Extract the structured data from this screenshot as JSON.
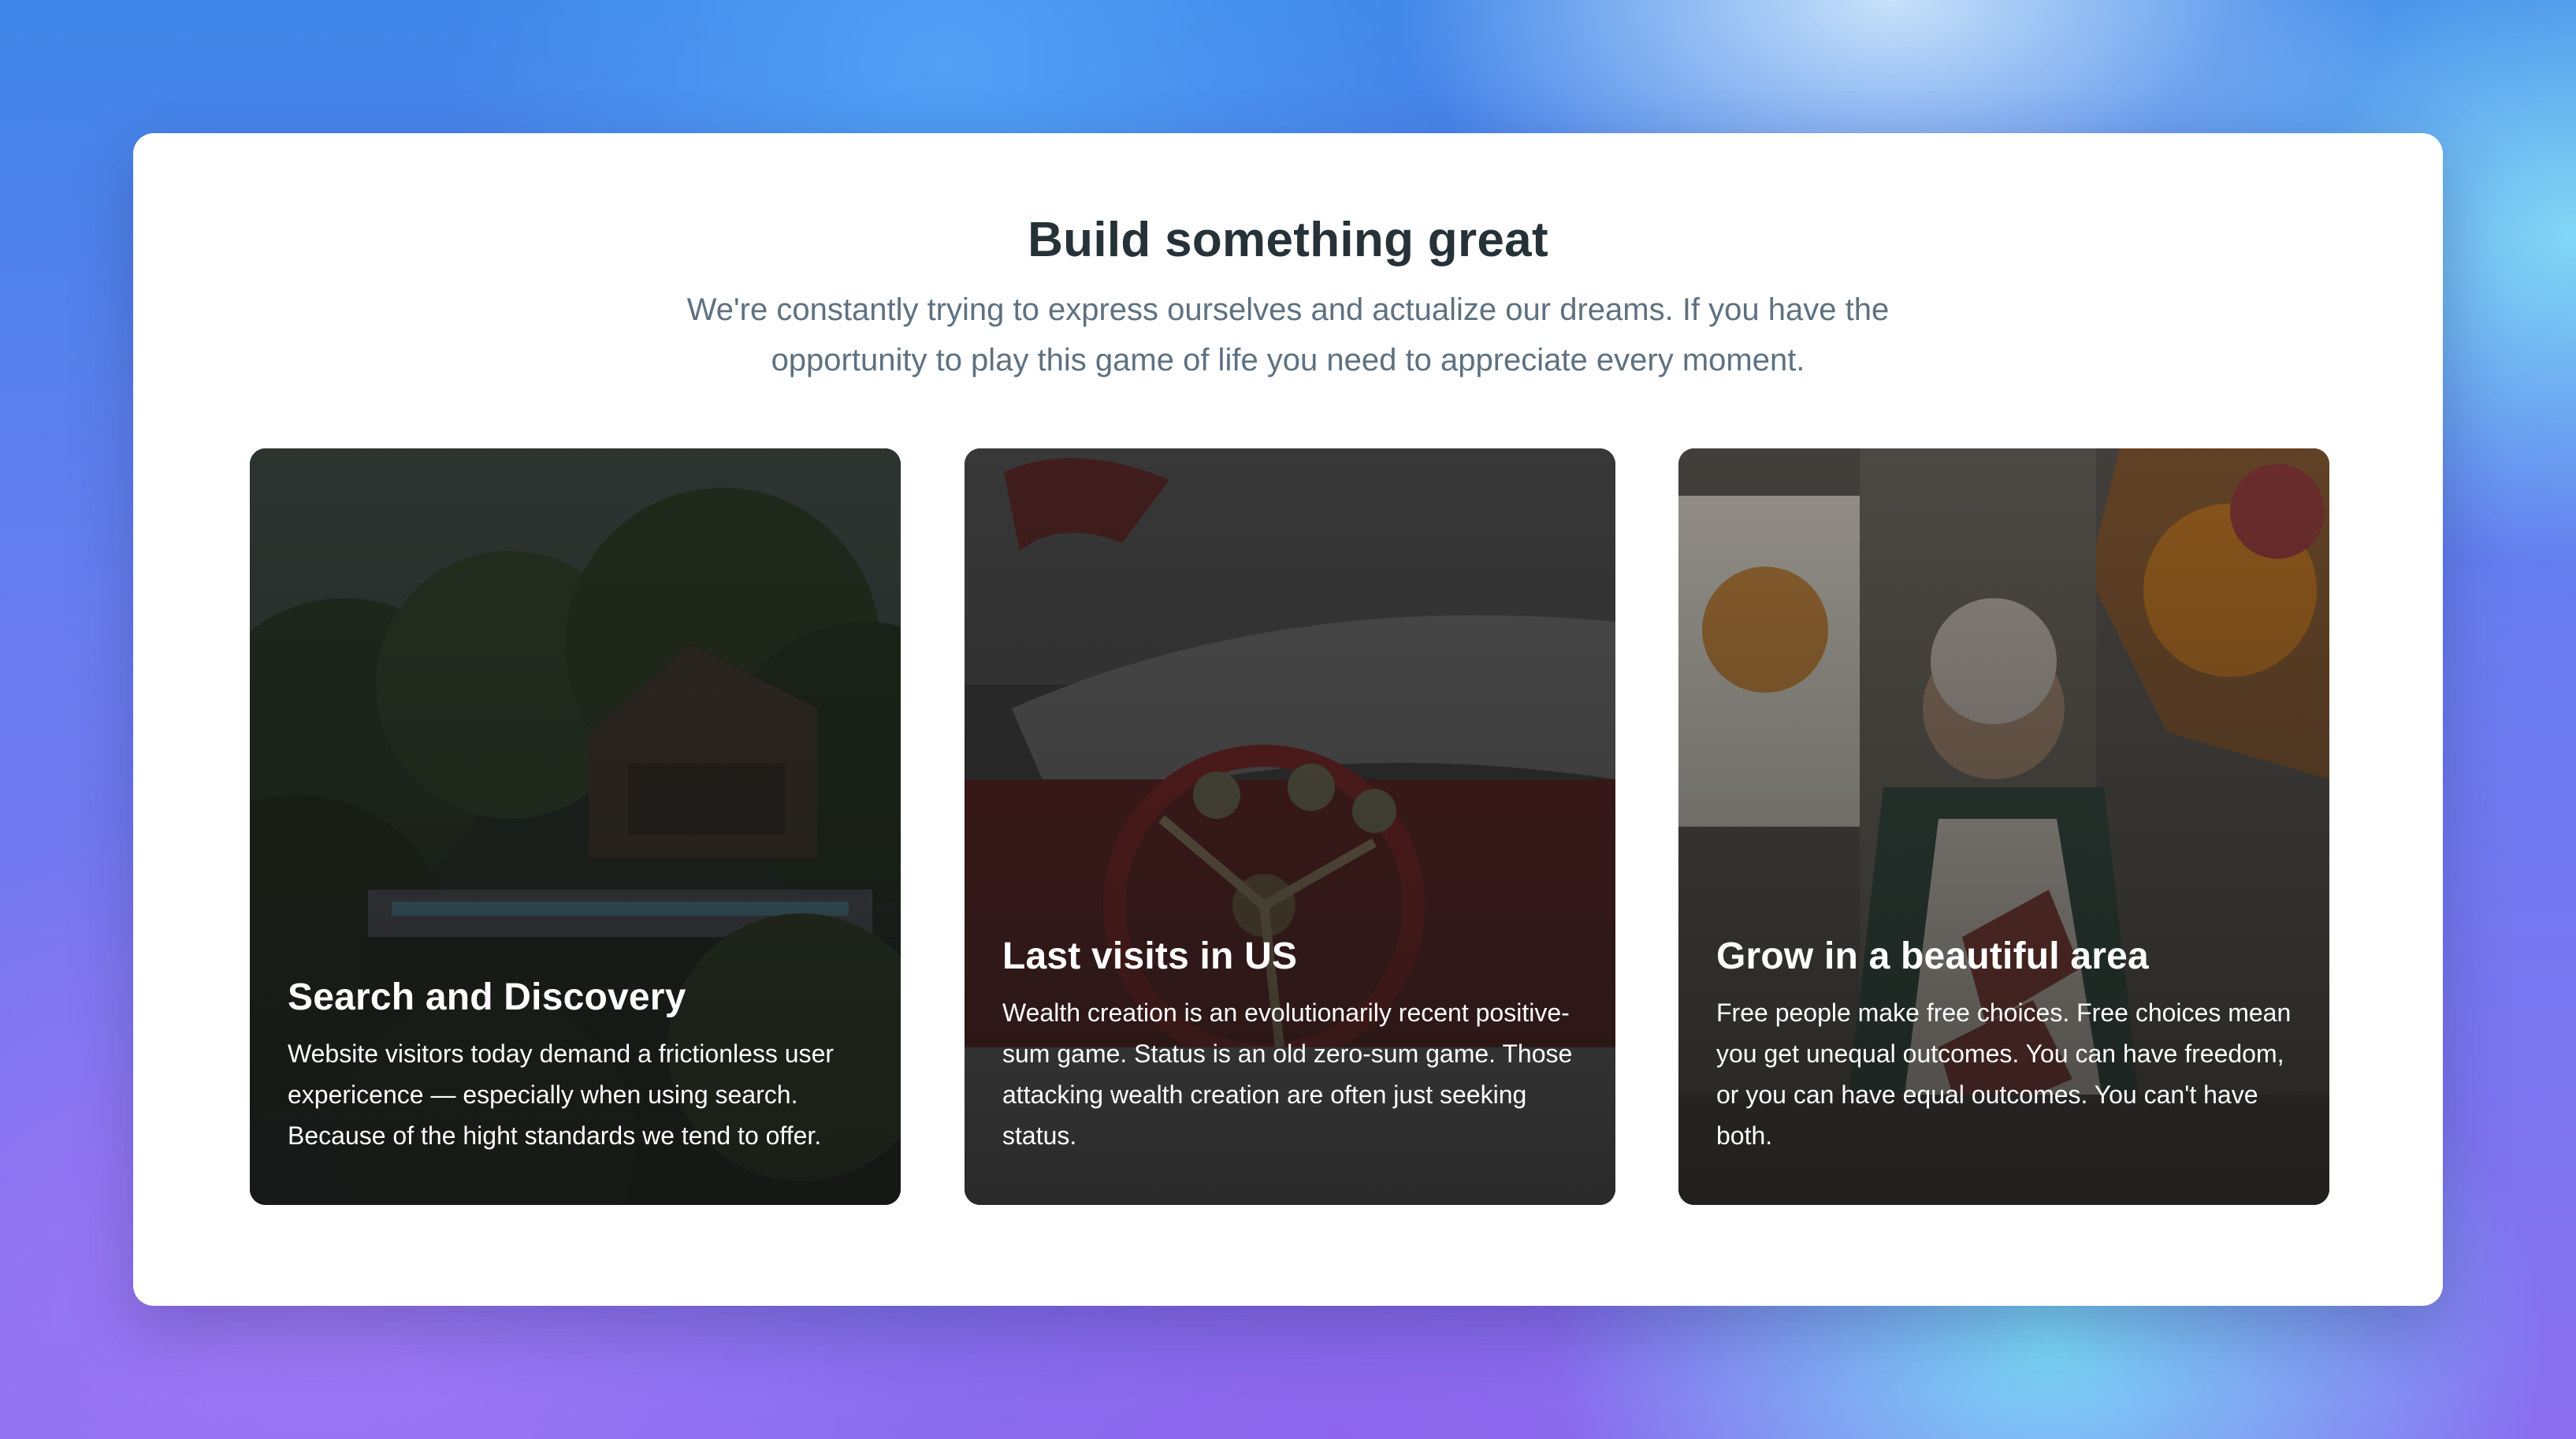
{
  "section": {
    "title": "Build something great",
    "subtitle": "We're constantly trying to express ourselves and actualize our dreams. If you have the opportunity to play this game of life you need to appreciate every moment."
  },
  "cards": [
    {
      "title": "Search and Discovery",
      "description": "Website visitors today demand a frictionless user expericence — especially when using search. Because of the hight standards we tend to offer.",
      "image": "forest-house-photo"
    },
    {
      "title": "Last visits in US",
      "description": "Wealth creation is an evolutionarily recent positive-sum game. Status is an old zero-sum game. Those attacking wealth creation are often just seeking status.",
      "image": "vintage-car-interior-photo"
    },
    {
      "title": "Grow in a beautiful area",
      "description": "Free people make free choices. Free choices mean you get unequal outcomes. You can have freedom, or you can have equal outcomes. You can't have both.",
      "image": "painter-in-studio-photo"
    }
  ]
}
